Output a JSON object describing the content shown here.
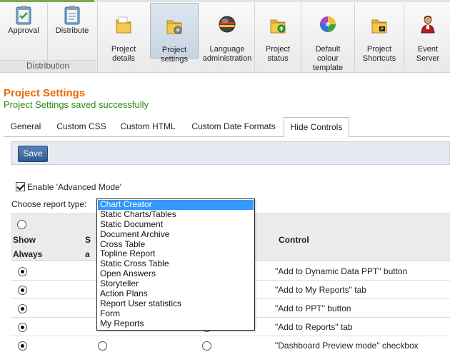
{
  "ribbon": {
    "group_label": "Distribution",
    "buttons": [
      {
        "label": "Approval"
      },
      {
        "label": "Distribute"
      },
      {
        "label": "Project\ndetails"
      },
      {
        "label": "Project\nsettings",
        "active": true
      },
      {
        "label": "Language\nadministration"
      },
      {
        "label": "Project\nstatus"
      },
      {
        "label": "Default\ncolour\ntemplate"
      },
      {
        "label": "Project\nShortcuts"
      },
      {
        "label": "Event\nServer"
      }
    ],
    "icons": [
      "clipboard-check-icon",
      "clipboard-icon",
      "folder-icon",
      "folder-gear-icon",
      "globe-icon",
      "folder-up-icon",
      "color-wheel-icon",
      "folder-shortcut-icon",
      "server-user-icon"
    ]
  },
  "page": {
    "title": "Project Settings",
    "success_message": "Project Settings saved successfully"
  },
  "tabs": {
    "items": [
      "General",
      "Custom CSS",
      "Custom HTML",
      "Custom Date Formats",
      "Hide Controls"
    ],
    "active": "Hide Controls"
  },
  "toolbar": {
    "save_label": "Save"
  },
  "options": {
    "advanced_mode_label": "Enable 'Advanced Mode'",
    "advanced_mode_checked": true,
    "choose_report_label": "Choose report type:"
  },
  "table": {
    "headers": {
      "show_always_line1": "Show",
      "show_always_line2": "Always",
      "col2_partial_line1": "S",
      "col2_partial_line2": "a",
      "control": "Control"
    },
    "rows": [
      {
        "control": "\"Add to Dynamic Data PPT\" button"
      },
      {
        "control": "\"Add to My Reports\" tab"
      },
      {
        "control": "\"Add to PPT\" button"
      },
      {
        "control": "\"Add to Reports\" tab"
      },
      {
        "control": "\"Dashboard Preview mode\" checkbox"
      }
    ]
  },
  "report_type_dropdown": {
    "selected": "Chart Creator",
    "options": [
      "Chart Creator",
      "Static Charts/Tables",
      "Static Document",
      "Document Archive",
      "Cross Table",
      "Topline Report",
      "Static Cross Table",
      "Open Answers",
      "Storyteller",
      "Action Plans",
      "Report User statistics",
      "Form",
      "My Reports"
    ]
  },
  "colors": {
    "title": "#e46c0a",
    "success": "#2a8a12",
    "save_button": "#2f5a92",
    "selection": "#3399ff"
  }
}
